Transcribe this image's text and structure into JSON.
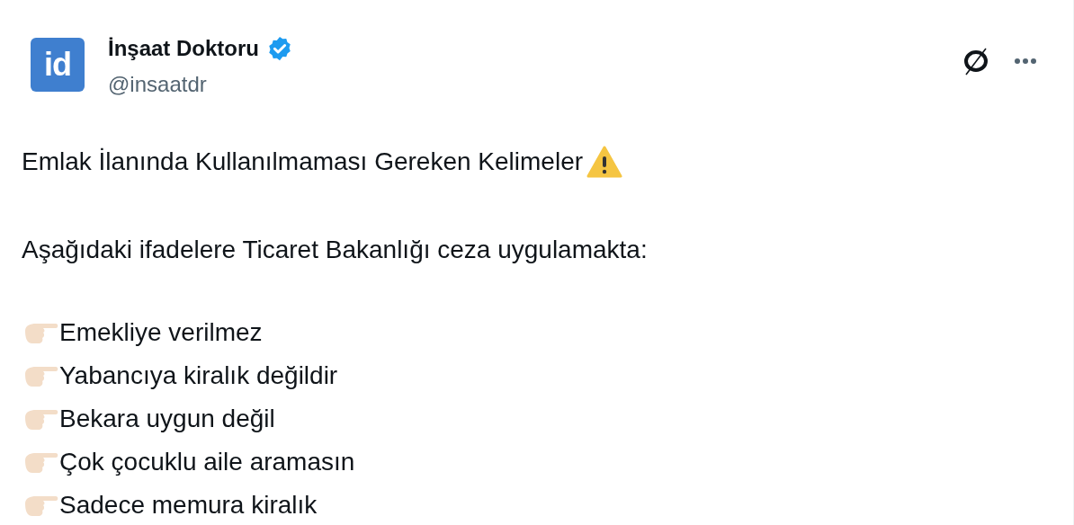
{
  "author": {
    "avatar_text": "id",
    "name": "İnşaat Doktoru",
    "verified": true,
    "handle": "@insaatdr"
  },
  "body": {
    "title": "Emlak İlanında Kullanılmaması Gereken Kelimeler",
    "intro": "Aşağıdaki ifadelere Ticaret Bakanlığı ceza uygulamakta:",
    "items": [
      "Emekliye verilmez",
      "Yabancıya kiralık değildir",
      "Bekara uygun değil",
      "Çok çocuklu aile aramasın",
      "Sadece memura kiralık"
    ]
  }
}
